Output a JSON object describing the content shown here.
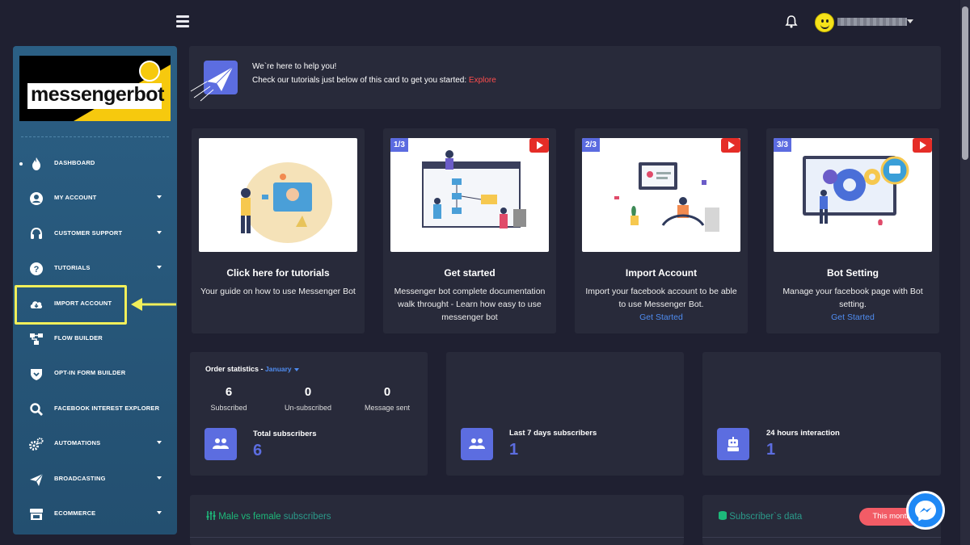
{
  "topbar": {
    "menu_icon": "hamburger-icon",
    "notification_icon": "bell-icon",
    "avatar_icon": "smiley-avatar"
  },
  "sidebar": {
    "logo": {
      "text_main": "messenger",
      "text_accent": "bot"
    },
    "items": [
      {
        "label": "DASHBOARD",
        "icon": "fire-icon",
        "active": true,
        "has_caret": false
      },
      {
        "label": "MY ACCOUNT",
        "icon": "user-icon",
        "has_caret": true
      },
      {
        "label": "CUSTOMER SUPPORT",
        "icon": "headset-icon",
        "has_caret": true
      },
      {
        "label": "TUTORIALS",
        "icon": "question-icon",
        "has_caret": true
      },
      {
        "label": "IMPORT ACCOUNT",
        "icon": "cloud-download-icon",
        "has_caret": false,
        "highlighted": true
      },
      {
        "label": "FLOW BUILDER",
        "icon": "flow-icon",
        "has_caret": false
      },
      {
        "label": "OPT-IN FORM BUILDER",
        "icon": "shield-icon",
        "has_caret": false
      },
      {
        "label": "FACEBOOK INTEREST EXPLORER",
        "icon": "search-icon",
        "has_caret": false
      },
      {
        "label": "AUTOMATIONS",
        "icon": "gears-icon",
        "has_caret": true
      },
      {
        "label": "BROADCASTING",
        "icon": "paper-plane-icon",
        "has_caret": true
      },
      {
        "label": "ECOMMERCE",
        "icon": "store-icon",
        "has_caret": true
      }
    ]
  },
  "help": {
    "title": "We`re here to help you!",
    "line": "Check our tutorials just below of this card to get you started:",
    "explore": "Explore"
  },
  "tutorials": [
    {
      "badge": "",
      "title": "Click here for tutorials",
      "desc": "Your guide on how to use Messenger Bot",
      "link": ""
    },
    {
      "badge": "1/3",
      "title": "Get started",
      "desc": "Messenger bot complete documentation walk throught - Learn how easy to use messenger bot",
      "link": ""
    },
    {
      "badge": "2/3",
      "title": "Import Account",
      "desc": "Import your facebook account to be able to use Messenger Bot.",
      "link": "Get Started"
    },
    {
      "badge": "3/3",
      "title": "Bot Setting",
      "desc": "Manage your facebook page with Bot setting.",
      "link": "Get Started"
    }
  ],
  "order_stats": {
    "heading": "Order statistics -",
    "month": "January",
    "items": [
      {
        "value": "6",
        "caption": "Subscribed"
      },
      {
        "value": "0",
        "caption": "Un-subscribed"
      },
      {
        "value": "0",
        "caption": "Message sent"
      }
    ],
    "total_label": "Total subscribers",
    "total_value": "6"
  },
  "stat_cards": [
    {
      "label": "Last 7 days subscribers",
      "value": "1",
      "icon": "users-icon"
    },
    {
      "label": "24 hours interaction",
      "value": "1",
      "icon": "robot-icon"
    }
  ],
  "bottom": {
    "gender_title": "Male vs female",
    "gender_title_rest": "subscribers",
    "data_title": "Subscriber`s data",
    "this_month": "This month"
  }
}
